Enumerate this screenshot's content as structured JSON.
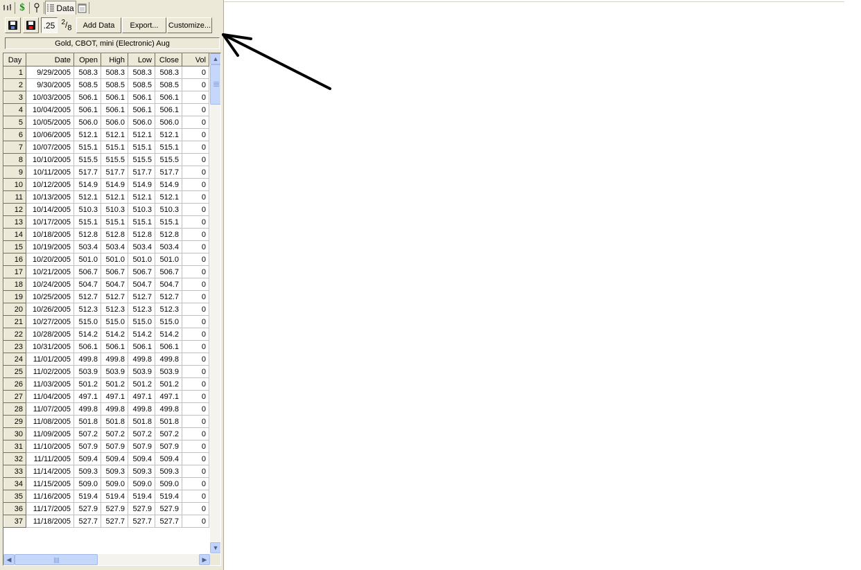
{
  "tabs": {
    "items": [
      {
        "name": "tab-chart",
        "icon": "bar-chart-icon"
      },
      {
        "name": "tab-dollar",
        "icon": "dollar-icon",
        "glyph": "$"
      },
      {
        "name": "tab-pin",
        "icon": "pin-icon"
      },
      {
        "name": "tab-data",
        "icon": "list-icon",
        "label": "Data"
      },
      {
        "name": "tab-notes",
        "icon": "notepad-icon"
      }
    ]
  },
  "toolbar": {
    "price_format": ".25",
    "fraction_num": "2",
    "fraction_den": "8",
    "add_data": "Add Data",
    "export": "Export...",
    "customize": "Customize..."
  },
  "instrument_title": "Gold, CBOT, mini (Electronic) Aug",
  "grid": {
    "columns": [
      "Day",
      "Date",
      "Open",
      "High",
      "Low",
      "Close",
      "Vol"
    ],
    "rows": [
      [
        "1",
        "9/29/2005",
        "508.3",
        "508.3",
        "508.3",
        "508.3",
        "0"
      ],
      [
        "2",
        "9/30/2005",
        "508.5",
        "508.5",
        "508.5",
        "508.5",
        "0"
      ],
      [
        "3",
        "10/03/2005",
        "506.1",
        "506.1",
        "506.1",
        "506.1",
        "0"
      ],
      [
        "4",
        "10/04/2005",
        "506.1",
        "506.1",
        "506.1",
        "506.1",
        "0"
      ],
      [
        "5",
        "10/05/2005",
        "506.0",
        "506.0",
        "506.0",
        "506.0",
        "0"
      ],
      [
        "6",
        "10/06/2005",
        "512.1",
        "512.1",
        "512.1",
        "512.1",
        "0"
      ],
      [
        "7",
        "10/07/2005",
        "515.1",
        "515.1",
        "515.1",
        "515.1",
        "0"
      ],
      [
        "8",
        "10/10/2005",
        "515.5",
        "515.5",
        "515.5",
        "515.5",
        "0"
      ],
      [
        "9",
        "10/11/2005",
        "517.7",
        "517.7",
        "517.7",
        "517.7",
        "0"
      ],
      [
        "10",
        "10/12/2005",
        "514.9",
        "514.9",
        "514.9",
        "514.9",
        "0"
      ],
      [
        "11",
        "10/13/2005",
        "512.1",
        "512.1",
        "512.1",
        "512.1",
        "0"
      ],
      [
        "12",
        "10/14/2005",
        "510.3",
        "510.3",
        "510.3",
        "510.3",
        "0"
      ],
      [
        "13",
        "10/17/2005",
        "515.1",
        "515.1",
        "515.1",
        "515.1",
        "0"
      ],
      [
        "14",
        "10/18/2005",
        "512.8",
        "512.8",
        "512.8",
        "512.8",
        "0"
      ],
      [
        "15",
        "10/19/2005",
        "503.4",
        "503.4",
        "503.4",
        "503.4",
        "0"
      ],
      [
        "16",
        "10/20/2005",
        "501.0",
        "501.0",
        "501.0",
        "501.0",
        "0"
      ],
      [
        "17",
        "10/21/2005",
        "506.7",
        "506.7",
        "506.7",
        "506.7",
        "0"
      ],
      [
        "18",
        "10/24/2005",
        "504.7",
        "504.7",
        "504.7",
        "504.7",
        "0"
      ],
      [
        "19",
        "10/25/2005",
        "512.7",
        "512.7",
        "512.7",
        "512.7",
        "0"
      ],
      [
        "20",
        "10/26/2005",
        "512.3",
        "512.3",
        "512.3",
        "512.3",
        "0"
      ],
      [
        "21",
        "10/27/2005",
        "515.0",
        "515.0",
        "515.0",
        "515.0",
        "0"
      ],
      [
        "22",
        "10/28/2005",
        "514.2",
        "514.2",
        "514.2",
        "514.2",
        "0"
      ],
      [
        "23",
        "10/31/2005",
        "506.1",
        "506.1",
        "506.1",
        "506.1",
        "0"
      ],
      [
        "24",
        "11/01/2005",
        "499.8",
        "499.8",
        "499.8",
        "499.8",
        "0"
      ],
      [
        "25",
        "11/02/2005",
        "503.9",
        "503.9",
        "503.9",
        "503.9",
        "0"
      ],
      [
        "26",
        "11/03/2005",
        "501.2",
        "501.2",
        "501.2",
        "501.2",
        "0"
      ],
      [
        "27",
        "11/04/2005",
        "497.1",
        "497.1",
        "497.1",
        "497.1",
        "0"
      ],
      [
        "28",
        "11/07/2005",
        "499.8",
        "499.8",
        "499.8",
        "499.8",
        "0"
      ],
      [
        "29",
        "11/08/2005",
        "501.8",
        "501.8",
        "501.8",
        "501.8",
        "0"
      ],
      [
        "30",
        "11/09/2005",
        "507.2",
        "507.2",
        "507.2",
        "507.2",
        "0"
      ],
      [
        "31",
        "11/10/2005",
        "507.9",
        "507.9",
        "507.9",
        "507.9",
        "0"
      ],
      [
        "32",
        "11/11/2005",
        "509.4",
        "509.4",
        "509.4",
        "509.4",
        "0"
      ],
      [
        "33",
        "11/14/2005",
        "509.3",
        "509.3",
        "509.3",
        "509.3",
        "0"
      ],
      [
        "34",
        "11/15/2005",
        "509.0",
        "509.0",
        "509.0",
        "509.0",
        "0"
      ],
      [
        "35",
        "11/16/2005",
        "519.4",
        "519.4",
        "519.4",
        "519.4",
        "0"
      ],
      [
        "36",
        "11/17/2005",
        "527.9",
        "527.9",
        "527.9",
        "527.9",
        "0"
      ],
      [
        "37",
        "11/18/2005",
        "527.7",
        "527.7",
        "527.7",
        "527.7",
        "0"
      ]
    ]
  },
  "annotation": {
    "icon": "arrow-annotation-icon",
    "color": "#000000"
  },
  "colors": {
    "panel_bg": "#ece9d8",
    "scrollbar": "#c1d3fb",
    "dollar": "#1c8a1c"
  }
}
